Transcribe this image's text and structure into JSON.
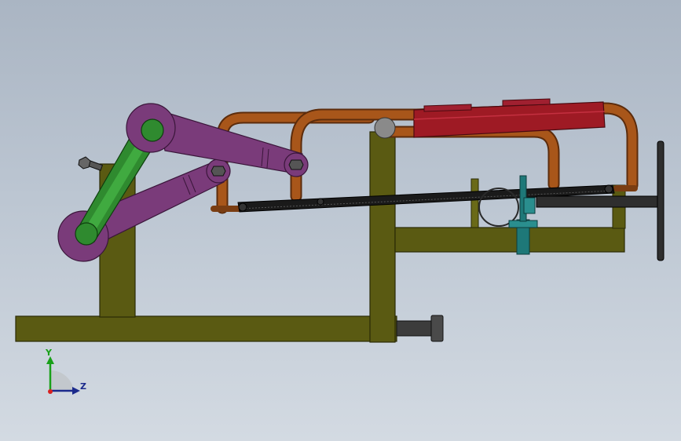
{
  "viewport": {
    "background_top": "#aab5c3",
    "background_bottom": "#d3dae2"
  },
  "model": {
    "parts": [
      {
        "name": "base-beam",
        "color": "#5a5a12"
      },
      {
        "name": "left-post",
        "color": "#5a5a12"
      },
      {
        "name": "center-post",
        "color": "#5a5a12"
      },
      {
        "name": "vise-frame",
        "color": "#5a5a12"
      },
      {
        "name": "crank-arm",
        "color": "#2f8a2f"
      },
      {
        "name": "connecting-rod-upper",
        "color": "#7a3b7a"
      },
      {
        "name": "connecting-rod-lower",
        "color": "#7a3b7a"
      },
      {
        "name": "hacksaw-frame",
        "color": "#a8561a"
      },
      {
        "name": "blade",
        "color": "#222222"
      },
      {
        "name": "guide-rail",
        "color": "#9e1a24"
      },
      {
        "name": "workpiece-pipe",
        "color": "#333333"
      },
      {
        "name": "vise-clamp",
        "color": "#1e7878"
      },
      {
        "name": "vise-screw",
        "color": "#2e2e2e"
      },
      {
        "name": "base-bolt",
        "color": "#3c3c3c"
      }
    ]
  },
  "triad": {
    "y_label": "Y",
    "z_label": "Z",
    "y_color": "#19a019",
    "z_color": "#1b2a8c"
  }
}
